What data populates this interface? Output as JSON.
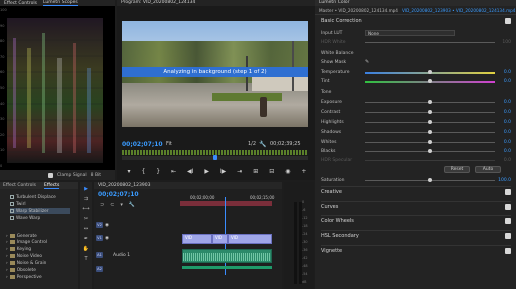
{
  "scopes": {
    "tabs": [
      "Effect Controls",
      "Lumetri Scopes"
    ],
    "ticks": [
      "100",
      "90",
      "80",
      "70",
      "60",
      "50",
      "40",
      "30",
      "20",
      "10",
      "0"
    ],
    "clamp_label": "Clamp Signal",
    "bit_label": "8 Bit"
  },
  "program": {
    "title": "Program: VID_20200802_124134",
    "banner": "Analyzing in background (step 1 of 2)",
    "timecode": "00;02;07;10",
    "fit": "Fit",
    "page": "1/2",
    "duration": "00;02;39;25"
  },
  "lumetri": {
    "tab": "Lumetri Color",
    "master": "Master • VID_20200802_124134.mp4",
    "clip": "VID_20200802_123903 • VID_20200802_124134.mp4",
    "basic_correction": "Basic Correction",
    "input_lut_label": "Input LUT",
    "input_lut_value": "None",
    "hdr_white_label": "HDR White",
    "hdr_white_value": "100",
    "white_balance": "White Balance",
    "show_mask": "Show Mask",
    "temperature_label": "Temperature",
    "temperature_value": "0.0",
    "tint_label": "Tint",
    "tint_value": "0.0",
    "tone": "Tone",
    "exposure_label": "Exposure",
    "exposure_value": "0.0",
    "contrast_label": "Contrast",
    "contrast_value": "0.0",
    "highlights_label": "Highlights",
    "highlights_value": "0.0",
    "shadows_label": "Shadows",
    "shadows_value": "0.0",
    "whites_label": "Whites",
    "whites_value": "0.0",
    "blacks_label": "Blacks",
    "blacks_value": "0.0",
    "hdr_specular_label": "HDR Specular",
    "hdr_specular_value": "0.0",
    "reset_label": "Reset",
    "auto_label": "Auto",
    "saturation_label": "Saturation",
    "saturation_value": "100.0",
    "sections": [
      "Creative",
      "Curves",
      "Color Wheels",
      "HSL Secondary",
      "Vignette"
    ]
  },
  "effects": {
    "tabs": [
      "Effect Controls",
      "Effects"
    ],
    "items": [
      "Turbulent Displace",
      "Twirl",
      "Warp Stabilizer",
      "Wave Warp"
    ],
    "folders": [
      "Generate",
      "Image Control",
      "Keying",
      "Noise & Grain",
      "Obsolete"
    ],
    "extra_folder": "Noise Video",
    "last": "Perspective"
  },
  "timeline": {
    "title": "VID_20200802_123903",
    "timecode": "00;02;07;10",
    "ruler": [
      "00;02;00;00",
      "00;02;15;00"
    ],
    "tracks": {
      "v2": "V2",
      "v1": "V1",
      "a1": "A1",
      "a2": "A2"
    },
    "clip_labels": [
      "VID",
      "VID",
      "VID"
    ],
    "audio_label": "Audio 1"
  },
  "meter": {
    "labels": [
      "0",
      "-6",
      "-12",
      "-18",
      "-24",
      "-30",
      "-36",
      "-42",
      "-48",
      "-54",
      "dB"
    ]
  }
}
